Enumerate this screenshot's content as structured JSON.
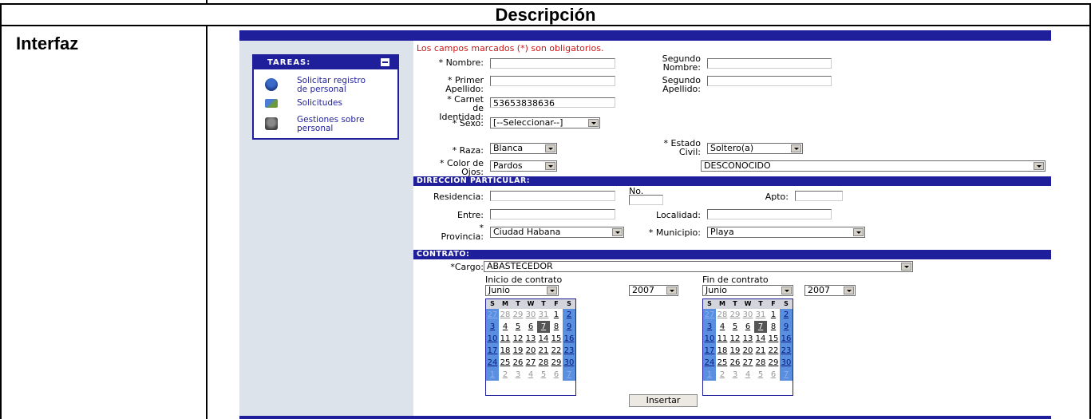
{
  "header": "Descripción",
  "row_label": "Interfaz",
  "sidebar": {
    "title": "TAREAS:",
    "items": [
      {
        "label": "Solicitar registro\nde personal",
        "icon": "user-icon"
      },
      {
        "label": "Solicitudes",
        "icon": "documents-icon"
      },
      {
        "label": "Gestiones sobre\npersonal",
        "icon": "trash-icon"
      }
    ]
  },
  "form": {
    "required_note": "Los campos marcados (*) son obligatorios.",
    "nombre_label": "* Nombre:",
    "segundo_nombre_label": "Segundo\nNombre:",
    "primer_apellido_label": "* Primer\nApellido:",
    "segundo_apellido_label": "Segundo\nApellido:",
    "carnet_label": "* Carnet\nde\nIdentidad:",
    "carnet_value": "53653838636",
    "sexo_label": "* Sexo:",
    "sexo_value": "[--Seleccionar--]",
    "raza_label": "* Raza:",
    "raza_value": "Blanca",
    "estado_civil_label": "* Estado\nCivil:",
    "estado_civil_value": "Soltero(a)",
    "color_ojos_label": "* Color de\nOjos:",
    "color_ojos_value": "Pardos",
    "desconocido_value": "DESCONOCIDO"
  },
  "direccion": {
    "title": "DIRECCIÓN PARTICULAR:",
    "residencia_label": "Residencia:",
    "no_label": "No.",
    "apto_label": "Apto:",
    "entre_label": "Entre:",
    "localidad_label": "Localidad:",
    "provincia_label": "*\nProvincia:",
    "provincia_value": "Ciudad Habana",
    "municipio_label": "* Municipio:",
    "municipio_value": "Playa"
  },
  "contrato": {
    "title": "CONTRATO:",
    "cargo_label": "*Cargo:",
    "cargo_value": "ABASTECEDOR",
    "inicio_label": "Inicio de contrato",
    "fin_label": "Fin de contrato",
    "month": "Junio",
    "year": "2007",
    "days_header": [
      "S",
      "M",
      "T",
      "W",
      "T",
      "F",
      "S"
    ],
    "weeks": [
      [
        "27",
        "28",
        "29",
        "30",
        "31",
        "1",
        "2"
      ],
      [
        "3",
        "4",
        "5",
        "6",
        "7",
        "8",
        "9"
      ],
      [
        "10",
        "11",
        "12",
        "13",
        "14",
        "15",
        "16"
      ],
      [
        "17",
        "18",
        "19",
        "20",
        "21",
        "22",
        "23"
      ],
      [
        "24",
        "25",
        "26",
        "27",
        "28",
        "29",
        "30"
      ],
      [
        "1",
        "2",
        "3",
        "4",
        "5",
        "6",
        "7"
      ]
    ],
    "submit_label": "Insertar"
  }
}
